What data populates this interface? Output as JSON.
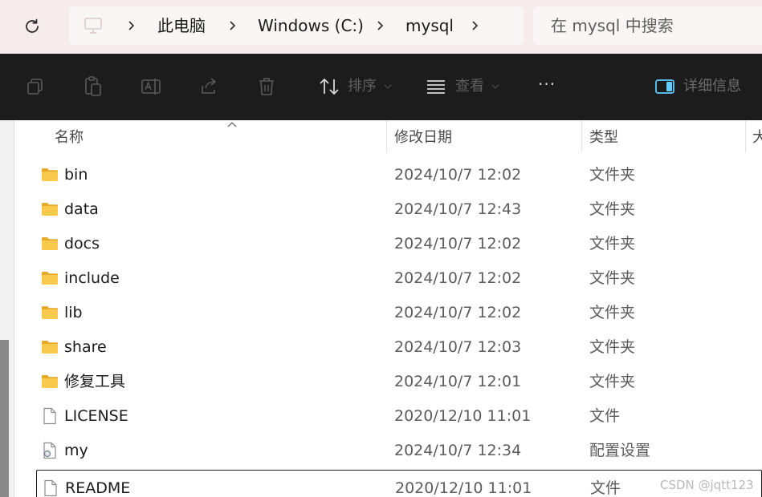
{
  "address": {
    "crumbs": [
      "此电脑",
      "Windows (C:)",
      "mysql"
    ],
    "search_placeholder": "在 mysql 中搜索"
  },
  "toolbar": {
    "icons": [
      "copy-icon",
      "paste-icon",
      "rename-icon",
      "share-icon",
      "delete-icon"
    ],
    "sort_label": "排序",
    "view_label": "查看",
    "more_label": "···",
    "details_label": "详细信息"
  },
  "columns": {
    "name": "名称",
    "date": "修改日期",
    "type": "类型",
    "size": "大"
  },
  "files": [
    {
      "name": "bin",
      "date": "2024/10/7 12:02",
      "type": "文件夹",
      "icon": "folder-icon"
    },
    {
      "name": "data",
      "date": "2024/10/7 12:43",
      "type": "文件夹",
      "icon": "folder-icon"
    },
    {
      "name": "docs",
      "date": "2024/10/7 12:02",
      "type": "文件夹",
      "icon": "folder-icon"
    },
    {
      "name": "include",
      "date": "2024/10/7 12:02",
      "type": "文件夹",
      "icon": "folder-icon"
    },
    {
      "name": "lib",
      "date": "2024/10/7 12:02",
      "type": "文件夹",
      "icon": "folder-icon"
    },
    {
      "name": "share",
      "date": "2024/10/7 12:03",
      "type": "文件夹",
      "icon": "folder-icon"
    },
    {
      "name": "修复工具",
      "date": "2024/10/7 12:01",
      "type": "文件夹",
      "icon": "folder-icon"
    },
    {
      "name": "LICENSE",
      "date": "2020/12/10 11:01",
      "type": "文件",
      "icon": "file-icon"
    },
    {
      "name": "my",
      "date": "2024/10/7 12:34",
      "type": "配置设置",
      "icon": "config-file-icon"
    },
    {
      "name": "README",
      "date": "2020/12/10 11:01",
      "type": "文件",
      "icon": "file-icon"
    }
  ],
  "watermark": "CSDN @jqtt123",
  "colors": {
    "address_bg": "#f7ecec",
    "toolbar_bg": "#1c1c1c",
    "folder_yellow": "#f8c94a",
    "details_accent": "#60cdff"
  }
}
